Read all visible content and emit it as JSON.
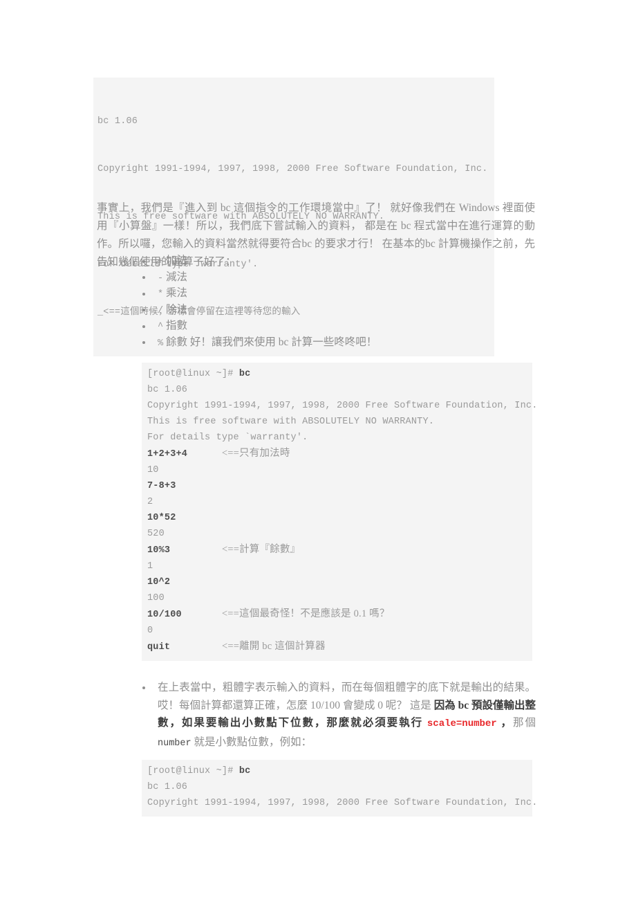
{
  "document": {
    "language": "zh-Hant",
    "background_color": "#ffffff",
    "body_text_color": "#8f8f8f",
    "code_background_color": "#f4f4f4",
    "accent_red": "#e8282b"
  },
  "code_block_1": {
    "name": "bc-startup-output",
    "lines": [
      {
        "text": "bc 1.06",
        "bold": false
      },
      {
        "text": "Copyright 1991-1994, 1997, 1998, 2000 Free Software Foundation, Inc.",
        "bold": false
      },
      {
        "text": "This is free software with ABSOLUTELY NO WARRANTY.",
        "bold": false
      },
      {
        "text": "For details type `warranty'.",
        "bold": false
      },
      {
        "text": "_<==這個時候，游標會停留在這裡等待您的輸入",
        "bold": false
      }
    ]
  },
  "intro_paragraph": {
    "text": "事實上，我們是『進入到 bc 這個指令的工作環境當中』了！ 就好像我們在 Windows 裡面使用『小算盤』一樣！所以，我們底下嘗試輸入的資料， 都是在 bc 程式當中在進行運算的動作。所以囉，您輸入的資料當然就得要符合bc 的要求才行！ 在基本的bc 計算機操作之前，先告知幾個使用的運算子好了："
  },
  "operator_list": {
    "items": [
      {
        "symbol": "+",
        "label": "加法"
      },
      {
        "symbol": "-",
        "label": "減法"
      },
      {
        "symbol": "*",
        "label": "乘法"
      },
      {
        "symbol": "/",
        "label": "除法"
      },
      {
        "symbol": "^",
        "label": "指數"
      },
      {
        "symbol": "%",
        "label": "餘數 好！讓我們來使用 bc 計算一些咚咚吧！"
      }
    ]
  },
  "code_block_2": {
    "name": "bc-session-example",
    "lines": [
      {
        "prompt": "[root@linux ~]# ",
        "command": "bc",
        "output": null,
        "comment": null
      },
      {
        "prompt": null,
        "command": null,
        "output": "bc 1.06",
        "comment": null
      },
      {
        "prompt": null,
        "command": null,
        "output": "Copyright 1991-1994, 1997, 1998, 2000 Free Software Foundation, Inc.",
        "comment": null
      },
      {
        "prompt": null,
        "command": null,
        "output": "This is free software with ABSOLUTELY NO WARRANTY.",
        "comment": null
      },
      {
        "prompt": null,
        "command": null,
        "output": "For details type `warranty'.",
        "comment": null
      },
      {
        "prompt": null,
        "command": "1+2+3+4",
        "output": null,
        "comment": "<==只有加法時"
      },
      {
        "prompt": null,
        "command": null,
        "output": "10",
        "comment": null
      },
      {
        "prompt": null,
        "command": "7-8+3",
        "output": null,
        "comment": null
      },
      {
        "prompt": null,
        "command": null,
        "output": "2",
        "comment": null
      },
      {
        "prompt": null,
        "command": "10*52",
        "output": null,
        "comment": null
      },
      {
        "prompt": null,
        "command": null,
        "output": "520",
        "comment": null
      },
      {
        "prompt": null,
        "command": "10%3",
        "output": null,
        "comment": "<==計算『餘數』"
      },
      {
        "prompt": null,
        "command": null,
        "output": "1",
        "comment": null
      },
      {
        "prompt": null,
        "command": "10^2",
        "output": null,
        "comment": null
      },
      {
        "prompt": null,
        "command": null,
        "output": "100",
        "comment": null
      },
      {
        "prompt": null,
        "command": "10/100",
        "output": null,
        "comment": "<==這個最奇怪！不是應該是 0.1 嗎？"
      },
      {
        "prompt": null,
        "command": null,
        "output": "0",
        "comment": null
      },
      {
        "prompt": null,
        "command": "quit",
        "output": null,
        "comment": "<==離開 bc 這個計算器"
      }
    ]
  },
  "note_bullet": {
    "part1": "在上表當中，粗體字表示輸入的資料，而在每個粗體字的底下就是輸出的結果。 哎！每個計算都還算正確，怎麼 10/100 會變成 0 呢？ 這是 ",
    "bold1": "因為 bc 預設僅輸出整數，如果要輸出小數點下位數，那麼就必須要執行 ",
    "code_red": "scale=number",
    "bold2": " ，",
    "part2": "那個 ",
    "mono": "number",
    "part3": " 就是小數點位數，例如："
  },
  "code_block_3": {
    "name": "bc-scale-example",
    "lines": [
      {
        "prompt": "[root@linux ~]# ",
        "command": "bc",
        "output": null
      },
      {
        "prompt": null,
        "command": null,
        "output": "bc 1.06"
      },
      {
        "prompt": null,
        "command": null,
        "output": "Copyright 1991-1994, 1997, 1998, 2000 Free Software Foundation, Inc."
      }
    ]
  }
}
